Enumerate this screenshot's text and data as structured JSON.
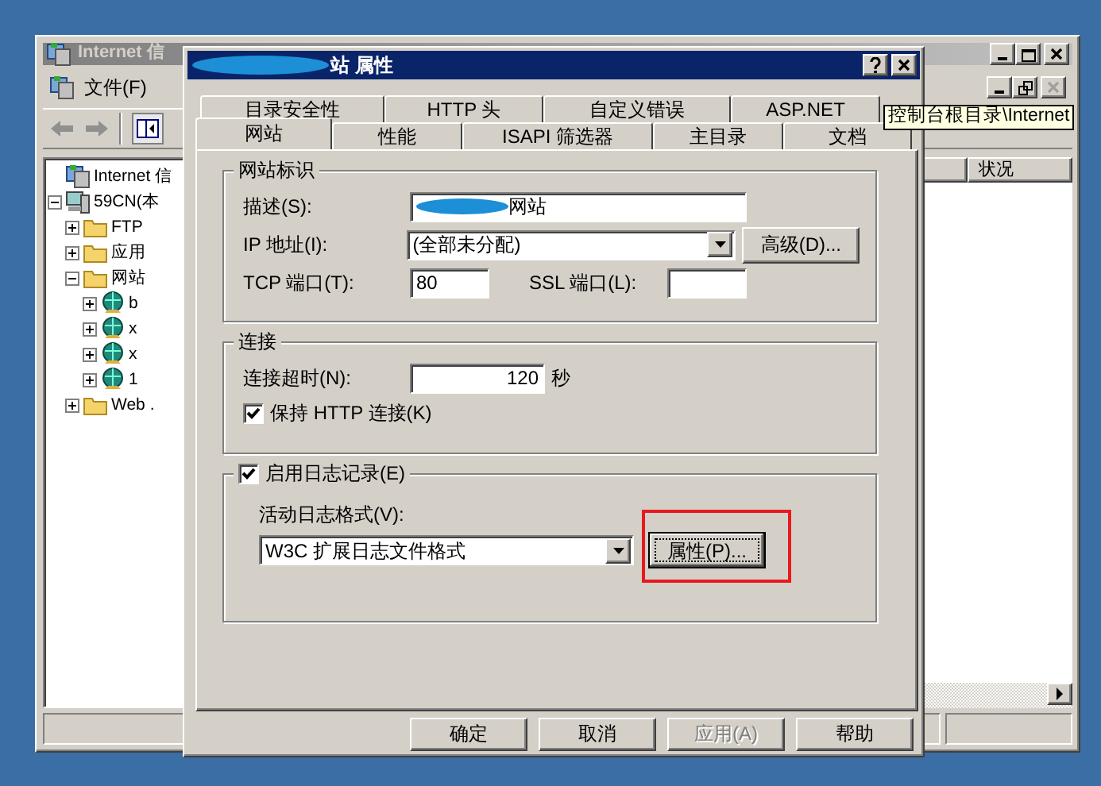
{
  "console_window": {
    "title": "Internet 信",
    "menu": [
      "文件(F)"
    ],
    "tooltip": "控制台根目录\\Internet",
    "tree": [
      {
        "label": "Internet 信",
        "kind": "console",
        "children": [
          {
            "label": "59CN(本",
            "kind": "computer",
            "expanded": true,
            "children": [
              {
                "label": "FTP",
                "kind": "folder",
                "expanded": false
              },
              {
                "label": "应用",
                "kind": "folder",
                "expanded": false
              },
              {
                "label": "网站",
                "kind": "folder",
                "expanded": true,
                "children": [
                  {
                    "label": "b",
                    "kind": "site",
                    "expanded": false
                  },
                  {
                    "label": "x",
                    "kind": "site",
                    "expanded": false
                  },
                  {
                    "label": "x",
                    "kind": "site",
                    "expanded": false
                  },
                  {
                    "label": "1",
                    "kind": "site",
                    "expanded": false
                  }
                ]
              },
              {
                "label": "Web .",
                "kind": "folder",
                "expanded": false
              }
            ]
          }
        ]
      }
    ],
    "list_columns": [
      "状况"
    ]
  },
  "dialog": {
    "title": "站 属性",
    "tabs_back": [
      {
        "label": "目录安全性",
        "selected": false
      },
      {
        "label": "HTTP 头",
        "selected": false
      },
      {
        "label": "自定义错误",
        "selected": false
      },
      {
        "label": "ASP.NET",
        "selected": false
      }
    ],
    "tabs_front": [
      {
        "label": "网站",
        "selected": true
      },
      {
        "label": "性能",
        "selected": false
      },
      {
        "label": "ISAPI 筛选器",
        "selected": false
      },
      {
        "label": "主目录",
        "selected": false
      },
      {
        "label": "文档",
        "selected": false
      }
    ],
    "identity": {
      "legend": "网站标识",
      "description_label": "描述(S):",
      "description_value": "网站",
      "ip_label": "IP 地址(I):",
      "ip_value": "(全部未分配)",
      "advanced_button": "高级(D)...",
      "tcp_label": "TCP 端口(T):",
      "tcp_value": "80",
      "ssl_label": "SSL 端口(L):"
    },
    "connection": {
      "legend": "连接",
      "timeout_label": "连接超时(N):",
      "timeout_value": "120",
      "timeout_unit": "秒",
      "keep_alive": {
        "label": "保持 HTTP 连接(K)",
        "checked": true
      }
    },
    "logging": {
      "label": "启用日志记录(E)",
      "checked": true,
      "format_label": "活动日志格式(V):",
      "format_value": "W3C 扩展日志文件格式",
      "properties_button": {
        "label": "属性(P)...",
        "focused": true,
        "highlighted": true
      }
    },
    "buttons": [
      {
        "label": "确定",
        "disabled": false
      },
      {
        "label": "取消",
        "disabled": false
      },
      {
        "label": "应用(A)",
        "disabled": true
      },
      {
        "label": "帮助",
        "disabled": false
      }
    ]
  }
}
